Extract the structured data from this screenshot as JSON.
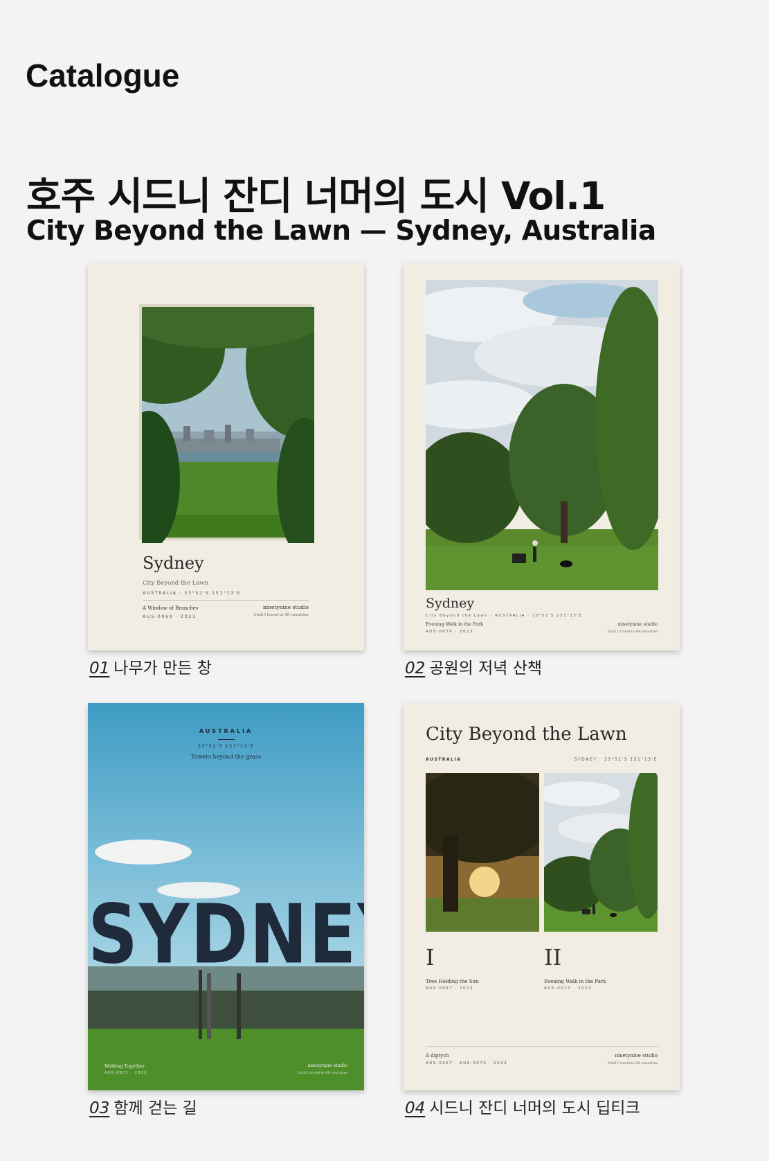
{
  "header": {
    "catalogue_label": "Catalogue",
    "title_ko": "호주 시드니 잔디 너머의 도시 Vol.1",
    "title_en": "City Beyond the Lawn — Sydney, Australia"
  },
  "posters": [
    {
      "title": "Sydney",
      "subtitle": "City Beyond the Lawn",
      "meta": "AUSTRALIA   ·   33°52'S  151°13'E",
      "work_title": "A Window of Branches",
      "code": "AUS-0069   ·   2023",
      "studio": "ninetynine studio",
      "tagline": "Until I travel to 99 countries",
      "caption_num": "01",
      "caption_text": "나무가 만든 창"
    },
    {
      "title": "Sydney",
      "meta": "City Beyond the Lawn   ·   AUSTRALIA   ·   33°52'S  151°13'E",
      "work_title": "Evening Walk in the Park",
      "code": "AUS-0070   ·   2023",
      "studio": "ninetynine studio",
      "tagline": "Until I travel to 99 countries",
      "caption_num": "02",
      "caption_text": "공원의 저녁 산책"
    },
    {
      "country": "AUSTRALIA",
      "coords": "33°52'S  151°13'E",
      "subtitle": "Towers beyond the grass",
      "big_title": "SYDNEY",
      "work_title": "Walking Together",
      "code": "AUS-0071   ·   2023",
      "studio": "ninetynine studio",
      "tagline": "Until I travel to 99 countries",
      "caption_num": "03",
      "caption_text": "함께 걷는 길"
    },
    {
      "title": "City Beyond the Lawn",
      "left_meta": "AUSTRALIA",
      "right_meta": "SYDNEY   ·   33°52'S  151°13'E",
      "panel1_numeral": "I",
      "panel1_title": "Tree Holding the Sun",
      "panel1_code": "AUS-0067   ·   2023",
      "panel2_numeral": "II",
      "panel2_title": "Evening Walk in the Park",
      "panel2_code": "AUS-0070   ·   2023",
      "work_title": "A diptych",
      "code": "AUS-0067 · AUS-0070   ·   2023",
      "studio": "ninetynine studio",
      "tagline": "Until I travel to 99 countries",
      "caption_num": "04",
      "caption_text": "시드니 잔디 너머의 도시 딥티크"
    }
  ]
}
